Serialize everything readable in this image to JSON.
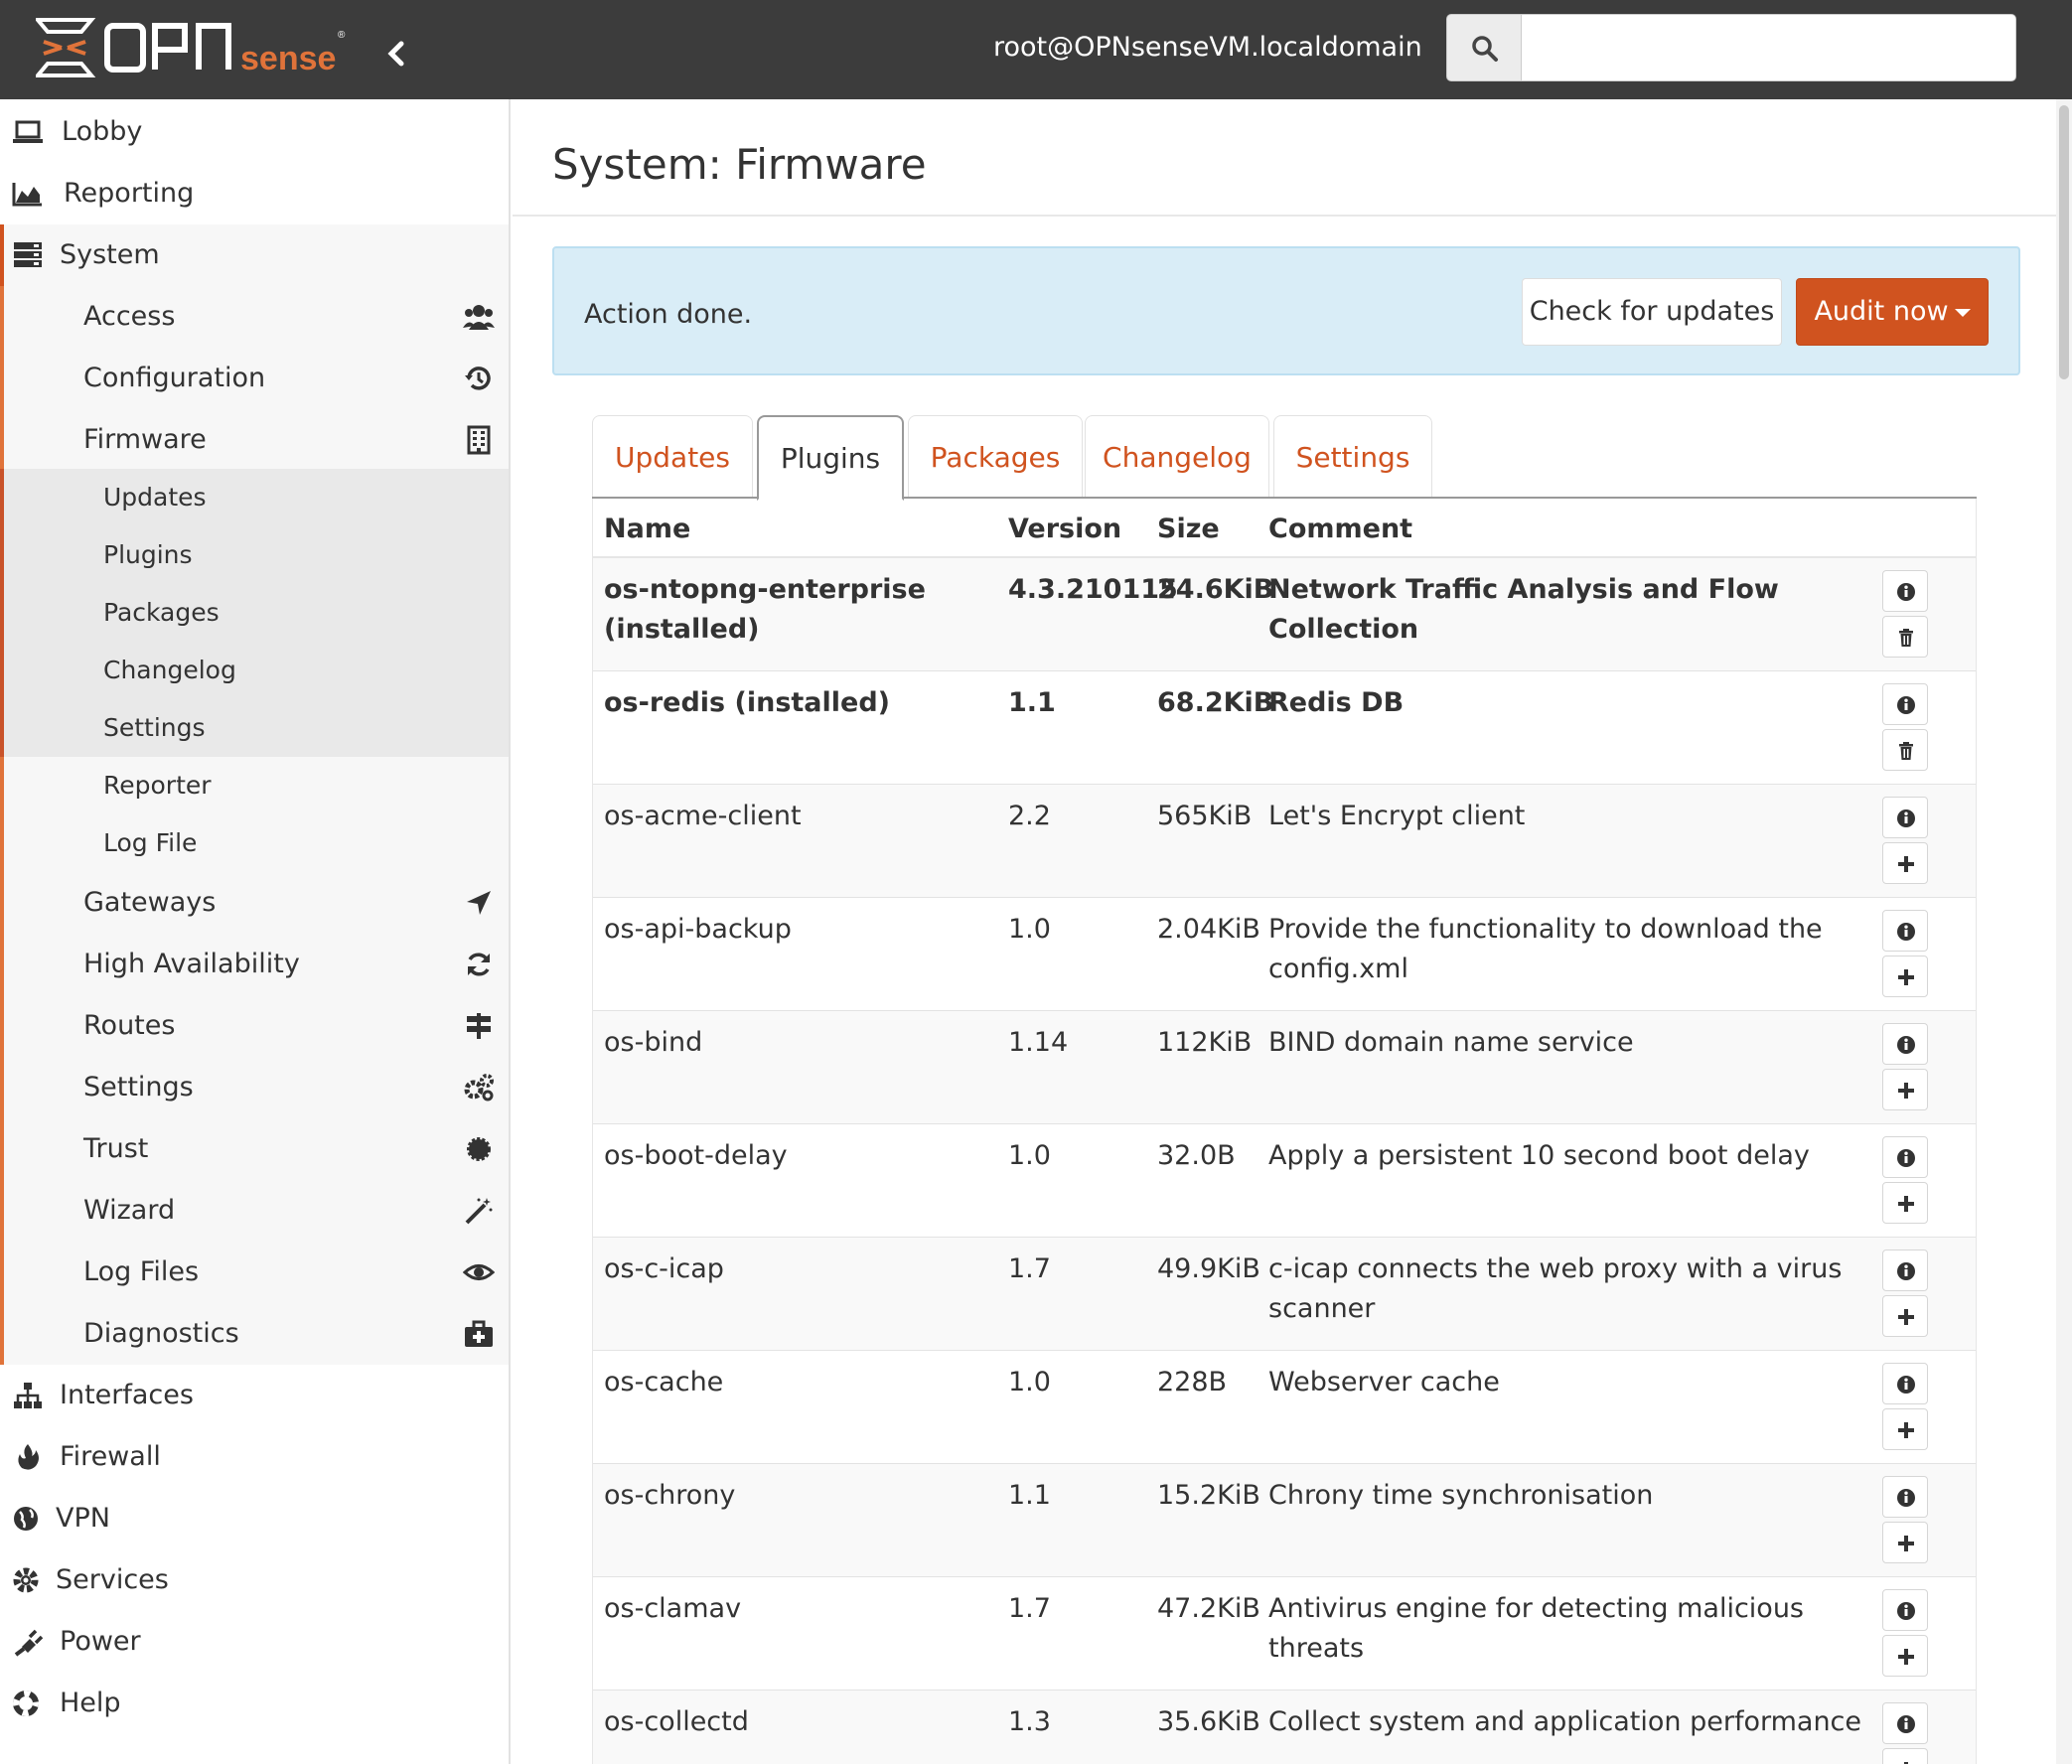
{
  "header": {
    "user": "root@OPNsenseVM.localdomain",
    "search_placeholder": "",
    "brand_colors": {
      "topbar": "#3c3c3c",
      "accent": "#d0531f"
    }
  },
  "sidebar": {
    "top_items": [
      {
        "label": "Lobby",
        "icon": "laptop-icon"
      },
      {
        "label": "Reporting",
        "icon": "area-chart-icon"
      },
      {
        "label": "System",
        "icon": "server-icon"
      }
    ],
    "system_items": [
      {
        "label": "Access",
        "icon": "users-icon"
      },
      {
        "label": "Configuration",
        "icon": "history-icon"
      },
      {
        "label": "Firmware",
        "icon": "building-icon"
      }
    ],
    "firmware_sub": [
      "Updates",
      "Plugins",
      "Packages",
      "Changelog",
      "Settings",
      "Reporter",
      "Log File"
    ],
    "system_items2": [
      {
        "label": "Gateways",
        "icon": "location-arrow-icon"
      },
      {
        "label": "High Availability",
        "icon": "refresh-icon"
      },
      {
        "label": "Routes",
        "icon": "signpost-icon"
      },
      {
        "label": "Settings",
        "icon": "cogs-icon"
      },
      {
        "label": "Trust",
        "icon": "certificate-icon"
      },
      {
        "label": "Wizard",
        "icon": "magic-wand-icon"
      },
      {
        "label": "Log Files",
        "icon": "eye-icon"
      },
      {
        "label": "Diagnostics",
        "icon": "medkit-icon"
      }
    ],
    "bottom_items": [
      {
        "label": "Interfaces",
        "icon": "sitemap-icon"
      },
      {
        "label": "Firewall",
        "icon": "fire-icon"
      },
      {
        "label": "VPN",
        "icon": "globe-icon"
      },
      {
        "label": "Services",
        "icon": "cog-icon"
      },
      {
        "label": "Power",
        "icon": "plug-icon"
      },
      {
        "label": "Help",
        "icon": "life-ring-icon"
      }
    ]
  },
  "main": {
    "title": "System: Firmware",
    "alert_text": "Action done.",
    "check_updates_label": "Check for updates",
    "audit_label": "Audit now",
    "tabs": [
      "Updates",
      "Plugins",
      "Packages",
      "Changelog",
      "Settings"
    ],
    "active_tab": "Plugins",
    "columns": [
      "Name",
      "Version",
      "Size",
      "Comment"
    ],
    "rows": [
      {
        "name": "os-ntopng-enterprise (installed)",
        "version": "4.3.210115",
        "size": "24.6KiB",
        "comment": "Network Traffic Analysis and Flow Collection",
        "installed": true
      },
      {
        "name": "os-redis (installed)",
        "version": "1.1",
        "size": "68.2KiB",
        "comment": "Redis DB",
        "installed": true
      },
      {
        "name": "os-acme-client",
        "version": "2.2",
        "size": "565KiB",
        "comment": "Let's Encrypt client",
        "installed": false
      },
      {
        "name": "os-api-backup",
        "version": "1.0",
        "size": "2.04KiB",
        "comment": "Provide the functionality to download the config.xml",
        "installed": false
      },
      {
        "name": "os-bind",
        "version": "1.14",
        "size": "112KiB",
        "comment": "BIND domain name service",
        "installed": false
      },
      {
        "name": "os-boot-delay",
        "version": "1.0",
        "size": "32.0B",
        "comment": "Apply a persistent 10 second boot delay",
        "installed": false
      },
      {
        "name": "os-c-icap",
        "version": "1.7",
        "size": "49.9KiB",
        "comment": "c-icap connects the web proxy with a virus scanner",
        "installed": false
      },
      {
        "name": "os-cache",
        "version": "1.0",
        "size": "228B",
        "comment": "Webserver cache",
        "installed": false
      },
      {
        "name": "os-chrony",
        "version": "1.1",
        "size": "15.2KiB",
        "comment": "Chrony time synchronisation",
        "installed": false
      },
      {
        "name": "os-clamav",
        "version": "1.7",
        "size": "47.2KiB",
        "comment": "Antivirus engine for detecting malicious threats",
        "installed": false
      },
      {
        "name": "os-collectd",
        "version": "1.3",
        "size": "35.6KiB",
        "comment": "Collect system and application performance",
        "installed": false
      }
    ]
  }
}
